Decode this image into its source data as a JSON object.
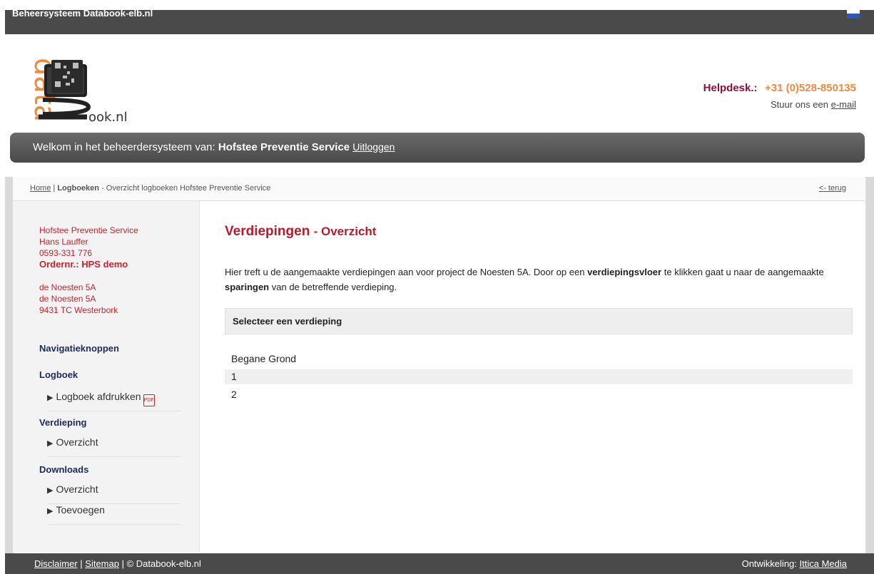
{
  "topbar": {
    "title": "Beheersysteem Databook-elb.nl"
  },
  "logo": {
    "brand": "data",
    "suffix": "ook.nl"
  },
  "helpdesk": {
    "label": "Helpdesk.:",
    "phone": "+31 (0)528-850135",
    "mail_prefix": "Stuur ons een",
    "mail_link": "e-mail"
  },
  "welcome": {
    "prefix": "Welkom in het beheerdersysteem van:",
    "company": "Hofstee Preventie Service",
    "logout": "Uitloggen"
  },
  "breadcrumb": {
    "home": "Home",
    "separator": "|",
    "current_bold": "Logboeken",
    "current_rest": "- Overzicht logboeken Hofstee Preventie Service",
    "back": "<- terug"
  },
  "sidebar": {
    "address": {
      "company": "Hofstee Preventie Service",
      "person": "Hans Lauffer",
      "phone": "0593-331 776",
      "order": "Ordernr.: HPS demo",
      "street1": "de Noesten 5A",
      "street2": "de Noesten 5A",
      "city": "9431 TC Westerbork"
    },
    "nav_title": "Navigatieknoppen",
    "sections": {
      "logboek": {
        "title": "Logboek",
        "items": [
          "Logboek afdrukken"
        ]
      },
      "verdieping": {
        "title": "Verdieping",
        "items": [
          "Overzicht"
        ]
      },
      "downloads": {
        "title": "Downloads",
        "items": [
          "Overzicht",
          "Toevoegen"
        ]
      }
    },
    "arrow": "▶"
  },
  "main": {
    "title": "Verdiepingen",
    "subtitle": "- Overzicht",
    "intro_1": "Hier treft u de aangemaakte verdiepingen aan voor project de Noesten 5A. Door op een",
    "intro_bold_1": "verdiepingsvloer",
    "intro_2": "te klikken gaat u naar de aangemaakte",
    "intro_bold_2": "sparingen",
    "intro_3": "van de betreffende verdieping.",
    "select_header": "Selecteer een verdieping",
    "floors": [
      "Begane Grond",
      "1",
      "2"
    ]
  },
  "footer": {
    "disclaimer": "Disclaimer",
    "sitemap": "Sitemap",
    "copyright": "| © Databook-elb.nl",
    "dev_label": "Ontwikkeling:",
    "dev_link": "Ittica Media"
  },
  "colors": {
    "accent": "#b71c2c",
    "brand_orange": "#f08a3c",
    "helpdesk_label": "#8e0f3b",
    "bar": "#4a4a4a"
  }
}
